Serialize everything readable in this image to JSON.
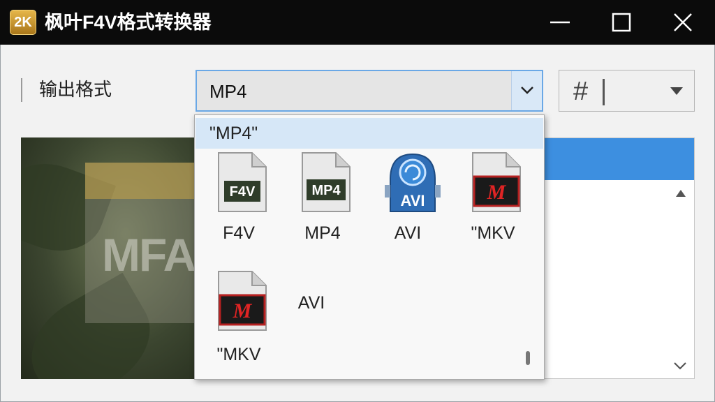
{
  "window": {
    "logo_text": "2K",
    "title": "枫叶F4V格式转换器"
  },
  "form": {
    "output_format_label": "输出格式",
    "selected_format": "MP4",
    "secondary_select_text": "#"
  },
  "dropdown": {
    "header_item": "\"MP4\"",
    "items": [
      {
        "label": "F4V",
        "icon": "f4v-file-icon",
        "badge": "F4V"
      },
      {
        "label": "MP4",
        "icon": "mp4-file-icon",
        "badge": "MP4"
      },
      {
        "label": "AVI",
        "icon": "avi-film-icon",
        "badge": "AVI"
      },
      {
        "label": "\"MKV",
        "icon": "mkv-file-icon",
        "badge": "M"
      },
      {
        "label": "\"MKV",
        "icon": "mkv-file-icon",
        "badge": "M"
      },
      {
        "label": "AVI",
        "icon": "none",
        "badge": ""
      }
    ]
  },
  "preview": {
    "watermark_text": "MFA"
  },
  "colors": {
    "titlebar": "#0b0b0b",
    "accent_blue": "#3d8fe0",
    "selection_blue": "#d6e7f7",
    "logo_gold": "#c9962d"
  }
}
